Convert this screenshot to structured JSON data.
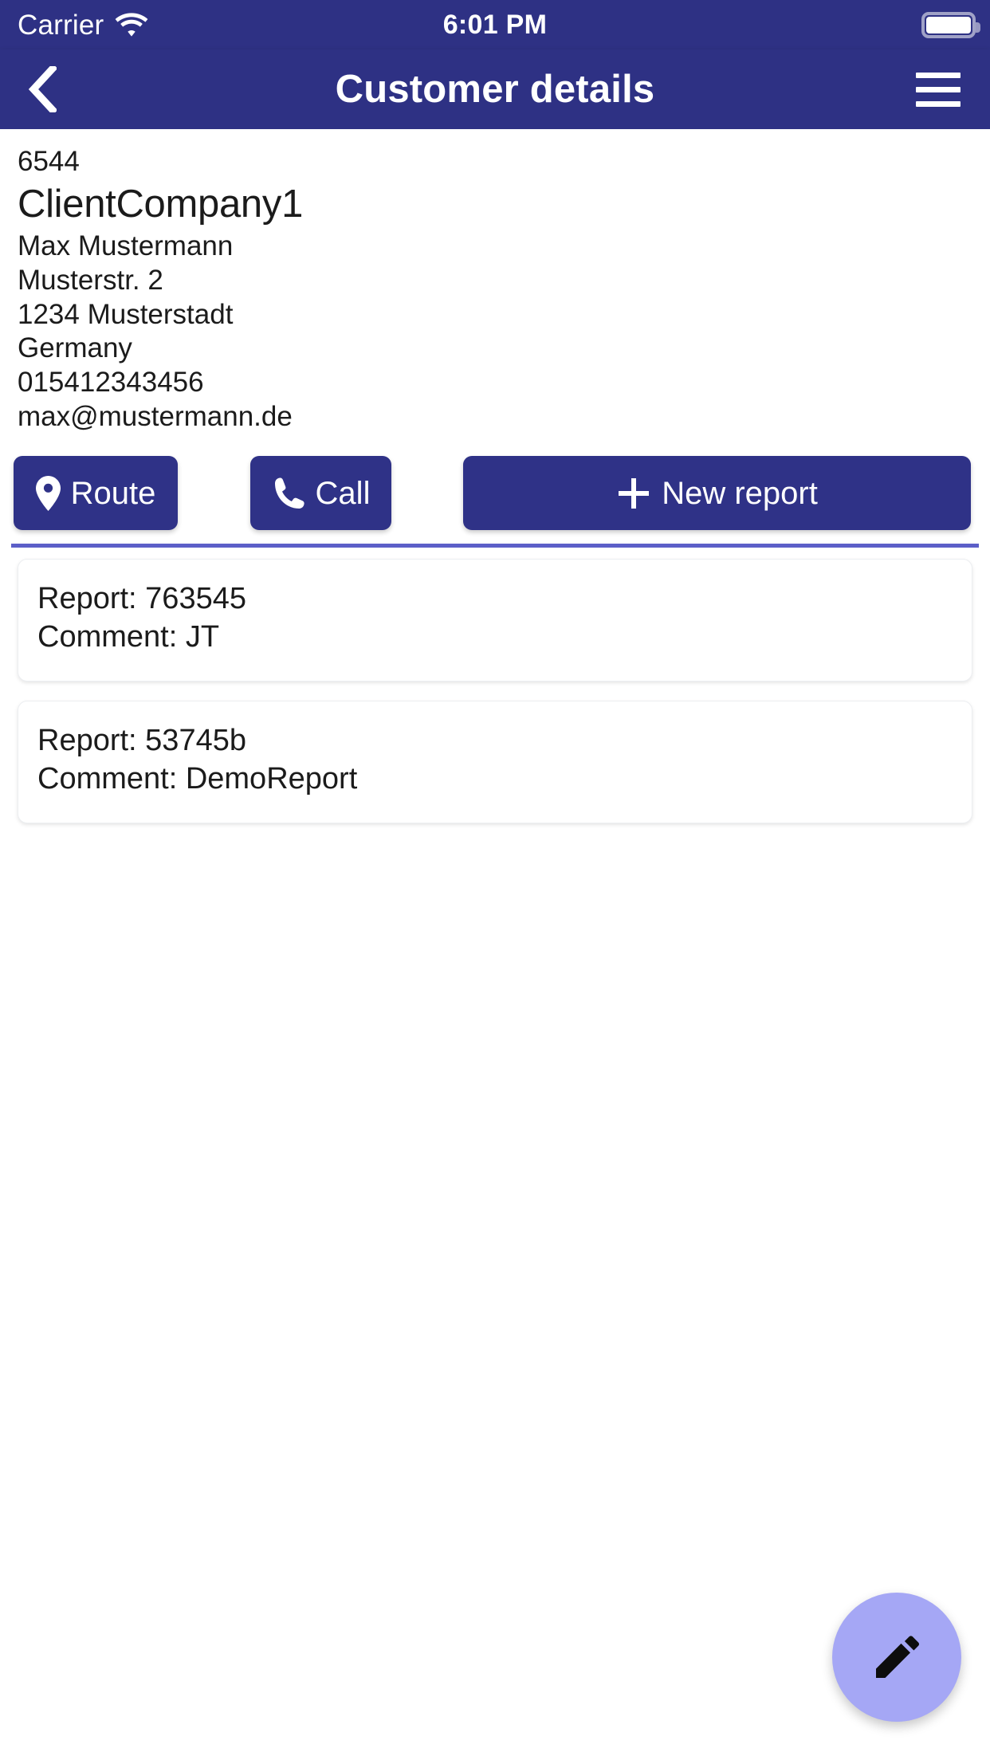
{
  "status_bar": {
    "carrier": "Carrier",
    "wifi_icon": "wifi-icon",
    "time": "6:01 PM",
    "battery_icon": "battery-full-icon"
  },
  "app_bar": {
    "back_icon": "chevron-left-icon",
    "title": "Customer details",
    "menu_icon": "hamburger-menu-icon",
    "background_color": "#2E3184"
  },
  "customer": {
    "id": "6544",
    "company": "ClientCompany1",
    "contact_name": "Max Mustermann",
    "street": "Musterstr. 2",
    "city": "1234 Musterstadt",
    "country": "Germany",
    "phone": "015412343456",
    "email": "max@mustermann.de"
  },
  "actions": [
    {
      "name": "route-button",
      "label": "Route",
      "icon": "map-pin-icon"
    },
    {
      "name": "call-button",
      "label": "Call",
      "icon": "phone-icon"
    },
    {
      "name": "new-report-button",
      "label": "New report",
      "icon": "plus-icon"
    }
  ],
  "action_button_color": "#2F3287",
  "divider_color": "#5C5FC8",
  "reports": [
    {
      "report": "Report: 763545",
      "comment": "Comment: JT"
    },
    {
      "report": "Report: 53745b",
      "comment": "Comment: DemoReport"
    }
  ],
  "fab": {
    "icon": "pencil-edit-icon",
    "color": "#A5A7F5"
  }
}
